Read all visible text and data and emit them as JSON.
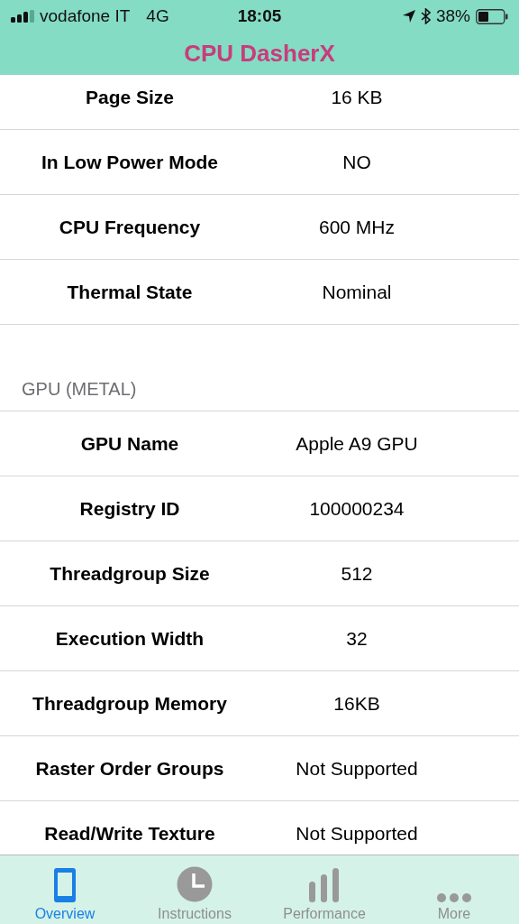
{
  "status_bar": {
    "carrier": "vodafone IT",
    "network": "4G",
    "time": "18:05",
    "battery": "38%"
  },
  "nav_bar": {
    "title": "CPU DasherX"
  },
  "sections": [
    {
      "rows": [
        {
          "label": "Page Size",
          "value": "16 KB"
        },
        {
          "label": "In Low Power Mode",
          "value": "NO"
        },
        {
          "label": "CPU Frequency",
          "value": "600 MHz"
        },
        {
          "label": "Thermal State",
          "value": "Nominal"
        }
      ]
    },
    {
      "header": "GPU (METAL)",
      "rows": [
        {
          "label": "GPU Name",
          "value": "Apple A9 GPU"
        },
        {
          "label": "Registry ID",
          "value": "100000234"
        },
        {
          "label": "Threadgroup Size",
          "value": "512"
        },
        {
          "label": "Execution Width",
          "value": "32"
        },
        {
          "label": "Threadgroup Memory",
          "value": "16KB"
        },
        {
          "label": "Raster Order Groups",
          "value": "Not Supported"
        },
        {
          "label": "Read/Write Texture",
          "value": "Not Supported"
        }
      ]
    }
  ],
  "tabs": [
    {
      "label": "Overview",
      "kind": "phone",
      "selected": true
    },
    {
      "label": "Instructions",
      "kind": "clock",
      "selected": false
    },
    {
      "label": "Performance",
      "kind": "bars",
      "selected": false
    },
    {
      "label": "More",
      "kind": "dots",
      "selected": false
    }
  ]
}
